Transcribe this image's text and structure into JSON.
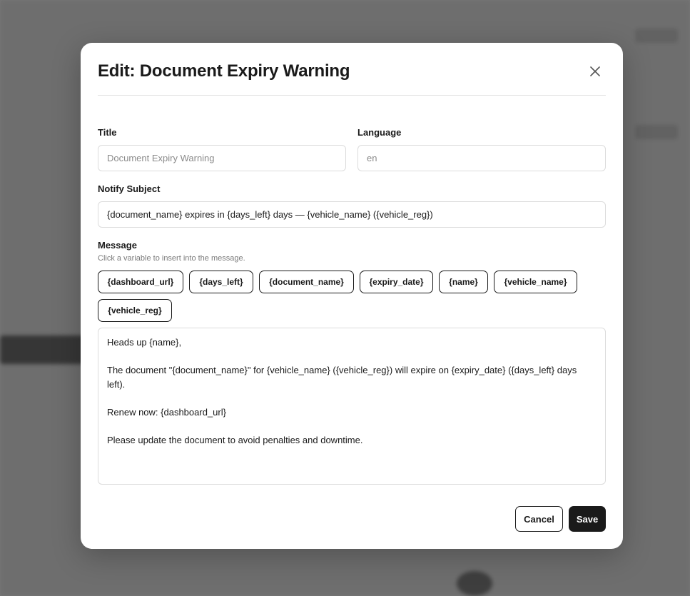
{
  "dialog": {
    "title": "Edit: Document Expiry Warning",
    "close_icon": "close-icon"
  },
  "form": {
    "title": {
      "label": "Title",
      "placeholder": "Document Expiry Warning"
    },
    "language": {
      "label": "Language",
      "placeholder": "en"
    },
    "notify_subject": {
      "label": "Notify Subject",
      "value": "{document_name} expires in {days_left} days — {vehicle_name} ({vehicle_reg})"
    },
    "message": {
      "label": "Message",
      "hint": "Click a variable to insert into the message.",
      "variables": [
        "{dashboard_url}",
        "{days_left}",
        "{document_name}",
        "{expiry_date}",
        "{name}",
        "{vehicle_name}",
        "{vehicle_reg}"
      ],
      "lines": [
        "Heads up {name},",
        "The document \"{document_name}\" for {vehicle_name} ({vehicle_reg}) will expire on {expiry_date} ({days_left} days left).",
        "Renew now: {dashboard_url}",
        "Please update the document to avoid penalties and downtime."
      ]
    }
  },
  "actions": {
    "cancel": "Cancel",
    "save": "Save"
  }
}
